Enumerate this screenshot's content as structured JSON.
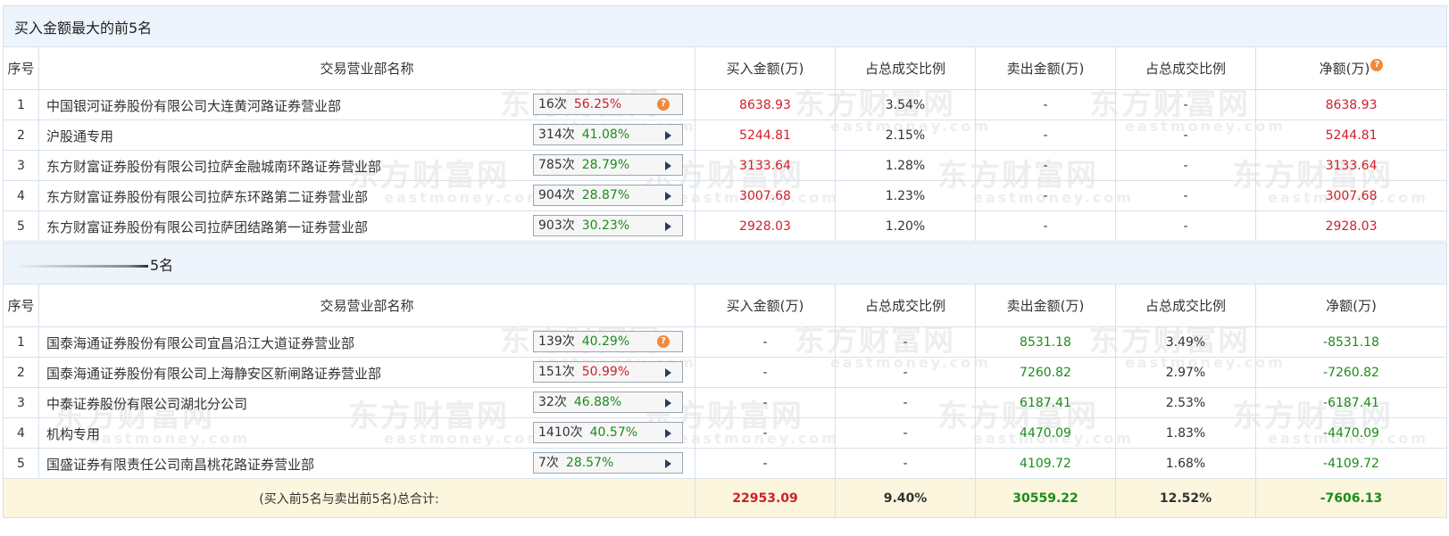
{
  "buy_section": {
    "title": "买入金额最大的前5名",
    "headers": [
      "序号",
      "交易营业部名称",
      "买入金额(万)",
      "占总成交比例",
      "卖出金额(万)",
      "占总成交比例",
      "净额(万)"
    ],
    "rows": [
      {
        "idx": "1",
        "name": "中国银河证券股份有限公司大连黄河路证券营业部",
        "count": "16次",
        "rate": "56.25%",
        "buy": "8638.93",
        "buy_pct": "3.54%",
        "sell": "-",
        "sell_pct": "-",
        "net": "8638.93"
      },
      {
        "idx": "2",
        "name": "沪股通专用",
        "count": "314次",
        "rate": "41.08%",
        "buy": "5244.81",
        "buy_pct": "2.15%",
        "sell": "-",
        "sell_pct": "-",
        "net": "5244.81"
      },
      {
        "idx": "3",
        "name": "东方财富证券股份有限公司拉萨金融城南环路证券营业部",
        "count": "785次",
        "rate": "28.79%",
        "buy": "3133.64",
        "buy_pct": "1.28%",
        "sell": "-",
        "sell_pct": "-",
        "net": "3133.64"
      },
      {
        "idx": "4",
        "name": "东方财富证券股份有限公司拉萨东环路第二证券营业部",
        "count": "904次",
        "rate": "28.87%",
        "buy": "3007.68",
        "buy_pct": "1.23%",
        "sell": "-",
        "sell_pct": "-",
        "net": "3007.68"
      },
      {
        "idx": "5",
        "name": "东方财富证券股份有限公司拉萨团结路第一证券营业部",
        "count": "903次",
        "rate": "30.23%",
        "buy": "2928.03",
        "buy_pct": "1.20%",
        "sell": "-",
        "sell_pct": "-",
        "net": "2928.03"
      }
    ]
  },
  "sell_section": {
    "title": "5名",
    "headers": [
      "序号",
      "交易营业部名称",
      "买入金额(万)",
      "占总成交比例",
      "卖出金额(万)",
      "占总成交比例",
      "净额(万)"
    ],
    "rows": [
      {
        "idx": "1",
        "name": "国泰海通证券股份有限公司宜昌沿江大道证券营业部",
        "count": "139次",
        "rate": "40.29%",
        "buy": "-",
        "buy_pct": "-",
        "sell": "8531.18",
        "sell_pct": "3.49%",
        "net": "-8531.18"
      },
      {
        "idx": "2",
        "name": "国泰海通证券股份有限公司上海静安区新闸路证券营业部",
        "count": "151次",
        "rate": "50.99%",
        "buy": "-",
        "buy_pct": "-",
        "sell": "7260.82",
        "sell_pct": "2.97%",
        "net": "-7260.82"
      },
      {
        "idx": "3",
        "name": "中泰证券股份有限公司湖北分公司",
        "count": "32次",
        "rate": "46.88%",
        "buy": "-",
        "buy_pct": "-",
        "sell": "6187.41",
        "sell_pct": "2.53%",
        "net": "-6187.41"
      },
      {
        "idx": "4",
        "name": "机构专用",
        "count": "1410次",
        "rate": "40.57%",
        "buy": "-",
        "buy_pct": "-",
        "sell": "4470.09",
        "sell_pct": "1.83%",
        "net": "-4470.09"
      },
      {
        "idx": "5",
        "name": "国盛证券有限责任公司南昌桃花路证券营业部",
        "count": "7次",
        "rate": "28.57%",
        "buy": "-",
        "buy_pct": "-",
        "sell": "4109.72",
        "sell_pct": "1.68%",
        "net": "-4109.72"
      }
    ]
  },
  "total": {
    "label": "(买入前5名与卖出前5名)总合计:",
    "buy": "22953.09",
    "buy_pct": "9.40%",
    "sell": "30559.22",
    "sell_pct": "12.52%",
    "net": "-7606.13"
  },
  "icons": {
    "help": "question-icon",
    "expand": "triangle-right-icon"
  },
  "help_glyph": "?",
  "watermark": {
    "cn": "东方财富网",
    "en": "eastmoney.com"
  },
  "colors": {
    "buy_red": "#d0202a",
    "sell_green": "#1b8c1b",
    "header_bg": "#eef4fb",
    "total_bg": "#fbf6dd",
    "help_orange": "#f08a3a"
  }
}
